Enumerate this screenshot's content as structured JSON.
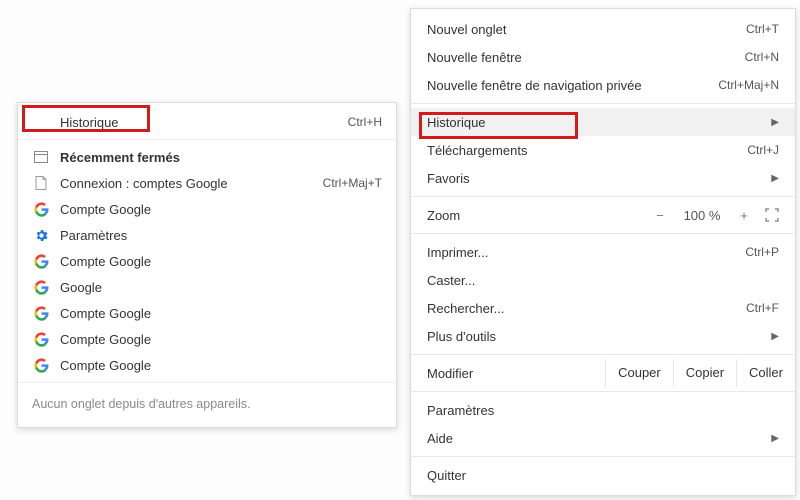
{
  "submenu": {
    "history": {
      "label": "Historique",
      "shortcut": "Ctrl+H"
    },
    "recently_closed_heading": "Récemment fermés",
    "items": [
      {
        "label": "Connexion : comptes Google",
        "shortcut": "Ctrl+Maj+T",
        "icon": "document"
      },
      {
        "label": "Compte Google",
        "icon": "google"
      },
      {
        "label": "Paramètres",
        "icon": "gear"
      },
      {
        "label": "Compte Google",
        "icon": "google"
      },
      {
        "label": "Google",
        "icon": "google"
      },
      {
        "label": "Compte Google",
        "icon": "google"
      },
      {
        "label": "Compte Google",
        "icon": "google"
      },
      {
        "label": "Compte Google",
        "icon": "google"
      }
    ],
    "footer": "Aucun onglet depuis d'autres appareils."
  },
  "mainmenu": {
    "items_top": [
      {
        "label": "Nouvel onglet",
        "shortcut": "Ctrl+T"
      },
      {
        "label": "Nouvelle fenêtre",
        "shortcut": "Ctrl+N"
      },
      {
        "label": "Nouvelle fenêtre de navigation privée",
        "shortcut": "Ctrl+Maj+N"
      }
    ],
    "items_mid1": [
      {
        "label": "Historique",
        "submenu": true,
        "selected": true
      },
      {
        "label": "Téléchargements",
        "shortcut": "Ctrl+J"
      },
      {
        "label": "Favoris",
        "submenu": true
      }
    ],
    "zoom": {
      "label": "Zoom",
      "minus": "−",
      "pct": "100 %",
      "plus": "+"
    },
    "items_mid2": [
      {
        "label": "Imprimer...",
        "shortcut": "Ctrl+P"
      },
      {
        "label": "Caster..."
      },
      {
        "label": "Rechercher...",
        "shortcut": "Ctrl+F"
      },
      {
        "label": "Plus d'outils",
        "submenu": true
      }
    ],
    "edit": {
      "label": "Modifier",
      "cut": "Couper",
      "copy": "Copier",
      "paste": "Coller"
    },
    "items_bottom": [
      {
        "label": "Paramètres"
      },
      {
        "label": "Aide",
        "submenu": true
      }
    ],
    "quit": {
      "label": "Quitter"
    }
  }
}
